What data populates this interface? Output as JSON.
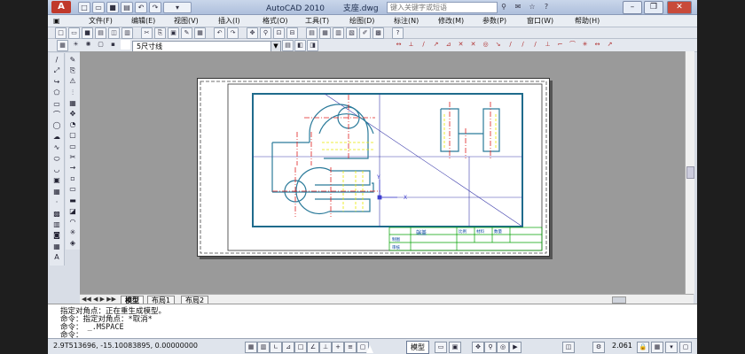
{
  "title_bar": {
    "logo_text": "A",
    "app_title": "AutoCAD 2010",
    "file_name": "支座.dwg",
    "search_placeholder": "键入关键字或短语",
    "window_buttons": [
      "–",
      "❐",
      "✕"
    ]
  },
  "menu": {
    "items": [
      "文件(F)",
      "编辑(E)",
      "视图(V)",
      "插入(I)",
      "格式(O)",
      "工具(T)",
      "绘图(D)",
      "标注(N)",
      "修改(M)",
      "参数(P)",
      "窗口(W)",
      "帮助(H)"
    ]
  },
  "layer_toolbar": {
    "current_layer": "5尺寸线"
  },
  "drawing": {
    "title_block": {
      "name": "端盖",
      "col1": "比例",
      "col2": "材料",
      "col3": "数量",
      "row1": "制图",
      "row2": "审核"
    },
    "ucs_labels": {
      "x": "X",
      "y": "Y"
    }
  },
  "layout_tabs": [
    "模型",
    "布局1",
    "布局2"
  ],
  "command_lines": [
    "指定对角点：正在重生成模型。",
    "命令：指定对角点：*取消*",
    "命令：  _.MSPACE",
    "命令："
  ],
  "status": {
    "coordinates": "2.9T513696,  -15.10083895,  0.00000000",
    "model_button": "模型",
    "annotation_scale": "2.061"
  },
  "colors": {
    "viewport_border": "#1f6b8c",
    "centerline": "#e02020",
    "hidden_line": "#e8e800",
    "title_block": "#00a000",
    "paper_bg": "#9a9a9a"
  }
}
